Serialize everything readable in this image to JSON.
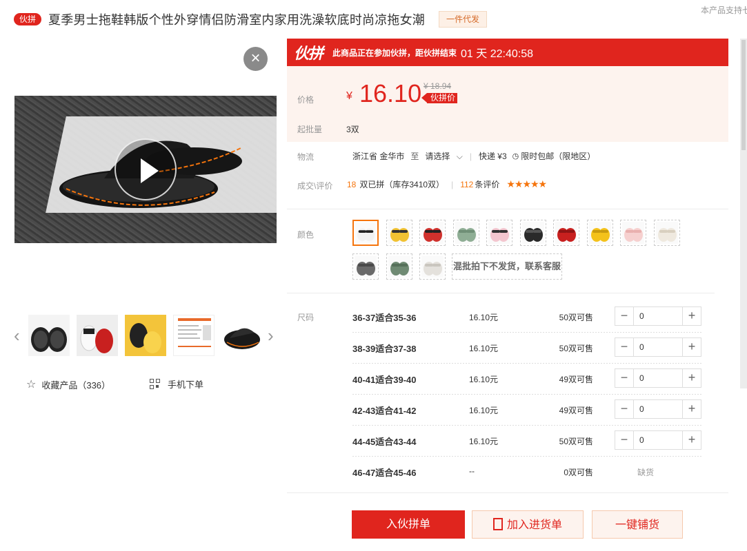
{
  "header": {
    "tag": "伙拼",
    "title": "夏季男士拖鞋韩版个性外穿情侣防滑室内家用洗澡软底时尚凉拖女潮",
    "badge": "一件代发",
    "support_text": "本产品支持七"
  },
  "gallery": {
    "close": "×",
    "thumbnails": [
      "black slipper",
      "white/red slippers",
      "yellow slippers",
      "size chart",
      "black slipper"
    ],
    "favorite_label": "收藏产品（336）",
    "mobile_label": "手机下单"
  },
  "promo": {
    "logo": "伙拼",
    "text": "此商品正在参加伙拼，距伙拼结束",
    "countdown": "01 天 22:40:58"
  },
  "pricing": {
    "price_label": "价格",
    "currency": "¥",
    "price": "16.10",
    "old_price": "¥ 18.94",
    "price_tag": "伙拼价",
    "moq_label": "起批量",
    "moq": "3双"
  },
  "logistics": {
    "label": "物流",
    "origin": "浙江省 金华市",
    "to": "至",
    "select": "请选择",
    "express": "快递 ¥3",
    "free_ship": "限时包邮（限地区）"
  },
  "reviews": {
    "label": "成交\\评价",
    "sold_count": "18",
    "sold_text": "双已拼（库存3410双）",
    "sep": "|",
    "review_count": "112",
    "review_text": "条评价",
    "rating": 4.5,
    "stars": "★★★★★"
  },
  "colors": {
    "label": "颜色",
    "swatches": [
      {
        "name": "white-black",
        "color": "#f2f2f2",
        "accent": "#222222"
      },
      {
        "name": "yellow-black",
        "color": "#f1c232",
        "accent": "#333333"
      },
      {
        "name": "red-black",
        "color": "#d0312d",
        "accent": "#222222"
      },
      {
        "name": "green",
        "color": "#8fae95",
        "accent": "#6f8f76"
      },
      {
        "name": "pink-black",
        "color": "#f3c6cf",
        "accent": "#333333"
      },
      {
        "name": "black",
        "color": "#2a2a2a",
        "accent": "#555555"
      },
      {
        "name": "red",
        "color": "#c8201f",
        "accent": "#8e1414"
      },
      {
        "name": "yellow",
        "color": "#f4c21b",
        "accent": "#c99b10"
      },
      {
        "name": "pink",
        "color": "#f6d0cf",
        "accent": "#e9b0ae"
      },
      {
        "name": "cream",
        "color": "#efe9df",
        "accent": "#d8cfbf"
      },
      {
        "name": "grey",
        "color": "#6a6a6a",
        "accent": "#4a4a4a"
      },
      {
        "name": "dark-green",
        "color": "#6f8a73",
        "accent": "#56705a"
      },
      {
        "name": "light-grey",
        "color": "#e4e1dc",
        "accent": "#c9c5be"
      }
    ],
    "mix_note": "混批拍下不发货，联系客服"
  },
  "sizes": {
    "label": "尺码",
    "rows": [
      {
        "name": "36-37适合35-36",
        "price": "16.10元",
        "stock": "50双可售",
        "qty": "0",
        "available": true
      },
      {
        "name": "38-39适合37-38",
        "price": "16.10元",
        "stock": "50双可售",
        "qty": "0",
        "available": true
      },
      {
        "name": "40-41适合39-40",
        "price": "16.10元",
        "stock": "49双可售",
        "qty": "0",
        "available": true
      },
      {
        "name": "42-43适合41-42",
        "price": "16.10元",
        "stock": "49双可售",
        "qty": "0",
        "available": true
      },
      {
        "name": "44-45适合43-44",
        "price": "16.10元",
        "stock": "50双可售",
        "qty": "0",
        "available": true
      },
      {
        "name": "46-47适合45-46",
        "price": "--",
        "stock": "0双可售",
        "qty": "",
        "available": false,
        "oos_text": "缺货"
      }
    ]
  },
  "actions": {
    "join": "入伙拼单",
    "add_cart": "加入进货单",
    "distribute": "一键铺货"
  }
}
